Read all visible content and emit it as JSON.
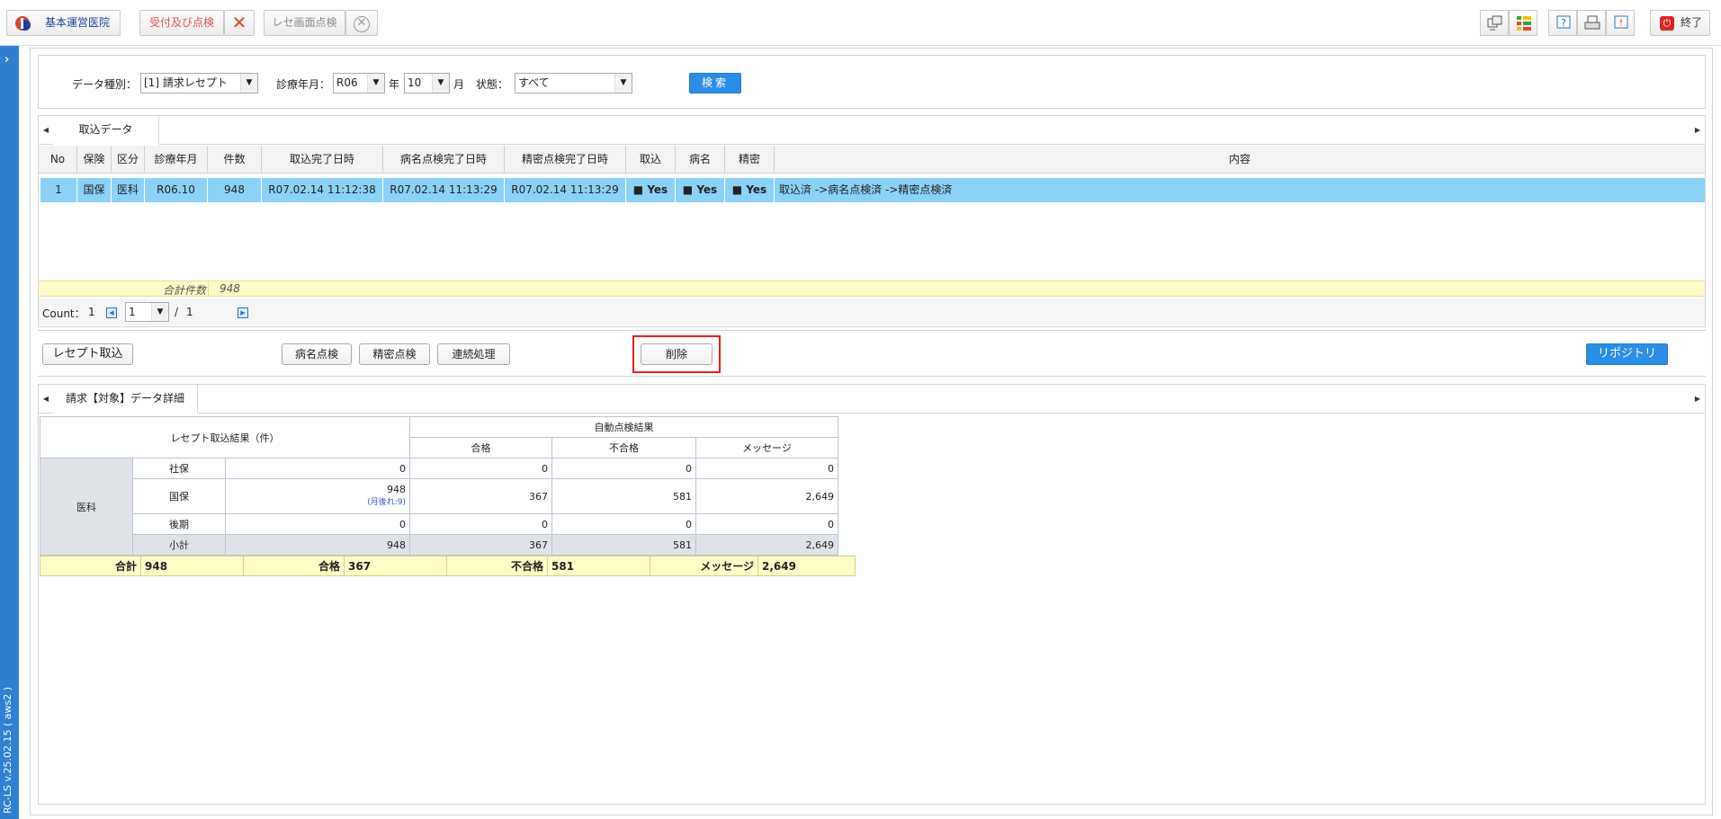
{
  "topbar": {
    "clinic_label": "基本運営医院",
    "reception_label": "受付及び点検",
    "rese_check_label": "レセ画面点検",
    "exit_label": "終了",
    "icons": [
      "transfer-icon",
      "status-list-icon",
      "help-icon",
      "print-icon",
      "notice-icon"
    ]
  },
  "sidebar": {
    "version": "RC-LS v.25.02.15 ( aws2 )"
  },
  "search": {
    "data_type_label": "データ種別：",
    "data_type_value": "[1] 請求レセプト",
    "date_label": "診療年月：",
    "era_value": "R06",
    "year_suffix": "年",
    "month_value": "10",
    "month_suffix": "月",
    "status_label": "状態：",
    "status_value": "すべて",
    "search_button": "検索"
  },
  "import_panel": {
    "tab_label": "取込データ",
    "columns": [
      "No",
      "保険",
      "区分",
      "診療年月",
      "件数",
      "取込完了日時",
      "病名点検完了日時",
      "精密点検完了日時",
      "取込",
      "病名",
      "精密",
      "内容"
    ],
    "rows": [
      [
        "1",
        "国保",
        "医科",
        "R06.10",
        "948",
        "R07.02.14 11:12:38",
        "R07.02.14 11:13:29",
        "R07.02.14 11:13:29",
        "■ Yes",
        "■ Yes",
        "■ Yes",
        "取込済 ->病名点検済 ->精密点検済"
      ]
    ],
    "total_label": "合計件数",
    "total_value": "948",
    "pager": {
      "count_label": "Count：",
      "count_value": "1",
      "page": "1",
      "separator": "/",
      "total_pages": "1"
    }
  },
  "actions": {
    "import_button": "レセプト取込",
    "disease_check_button": "病名点検",
    "detailed_check_button": "精密点検",
    "continuous_button": "連続処理",
    "delete_button": "削除",
    "repository_button": "リポジトリ"
  },
  "detail_panel": {
    "tab_label": "請求【対象】データ詳細",
    "import_result_header": "レセプト取込結果（件）",
    "auto_check_header": "自動点検結果",
    "sub_headers": [
      "合格",
      "不合格",
      "メッセージ"
    ],
    "group_label": "医科",
    "rows": [
      {
        "label": "社保",
        "count": "0",
        "pass": "0",
        "fail": "0",
        "msg": "0"
      },
      {
        "label": "国保",
        "count": "948",
        "note": "(月後れ:9)",
        "pass": "367",
        "fail": "581",
        "msg": "2,649"
      },
      {
        "label": "後期",
        "count": "0",
        "pass": "0",
        "fail": "0",
        "msg": "0"
      }
    ],
    "subtotal": {
      "label": "小計",
      "count": "948",
      "pass": "367",
      "fail": "581",
      "msg": "2,649"
    },
    "summary": [
      {
        "label": "合計",
        "value": "948"
      },
      {
        "label": "合格",
        "value": "367"
      },
      {
        "label": "不合格",
        "value": "581"
      },
      {
        "label": "メッセージ",
        "value": "2,649"
      }
    ]
  },
  "colors": {
    "accent": "#2b8ee6",
    "row_selected": "#8cd2f7",
    "total_bg": "#fdfbc6",
    "highlight_outline": "#e02020"
  }
}
